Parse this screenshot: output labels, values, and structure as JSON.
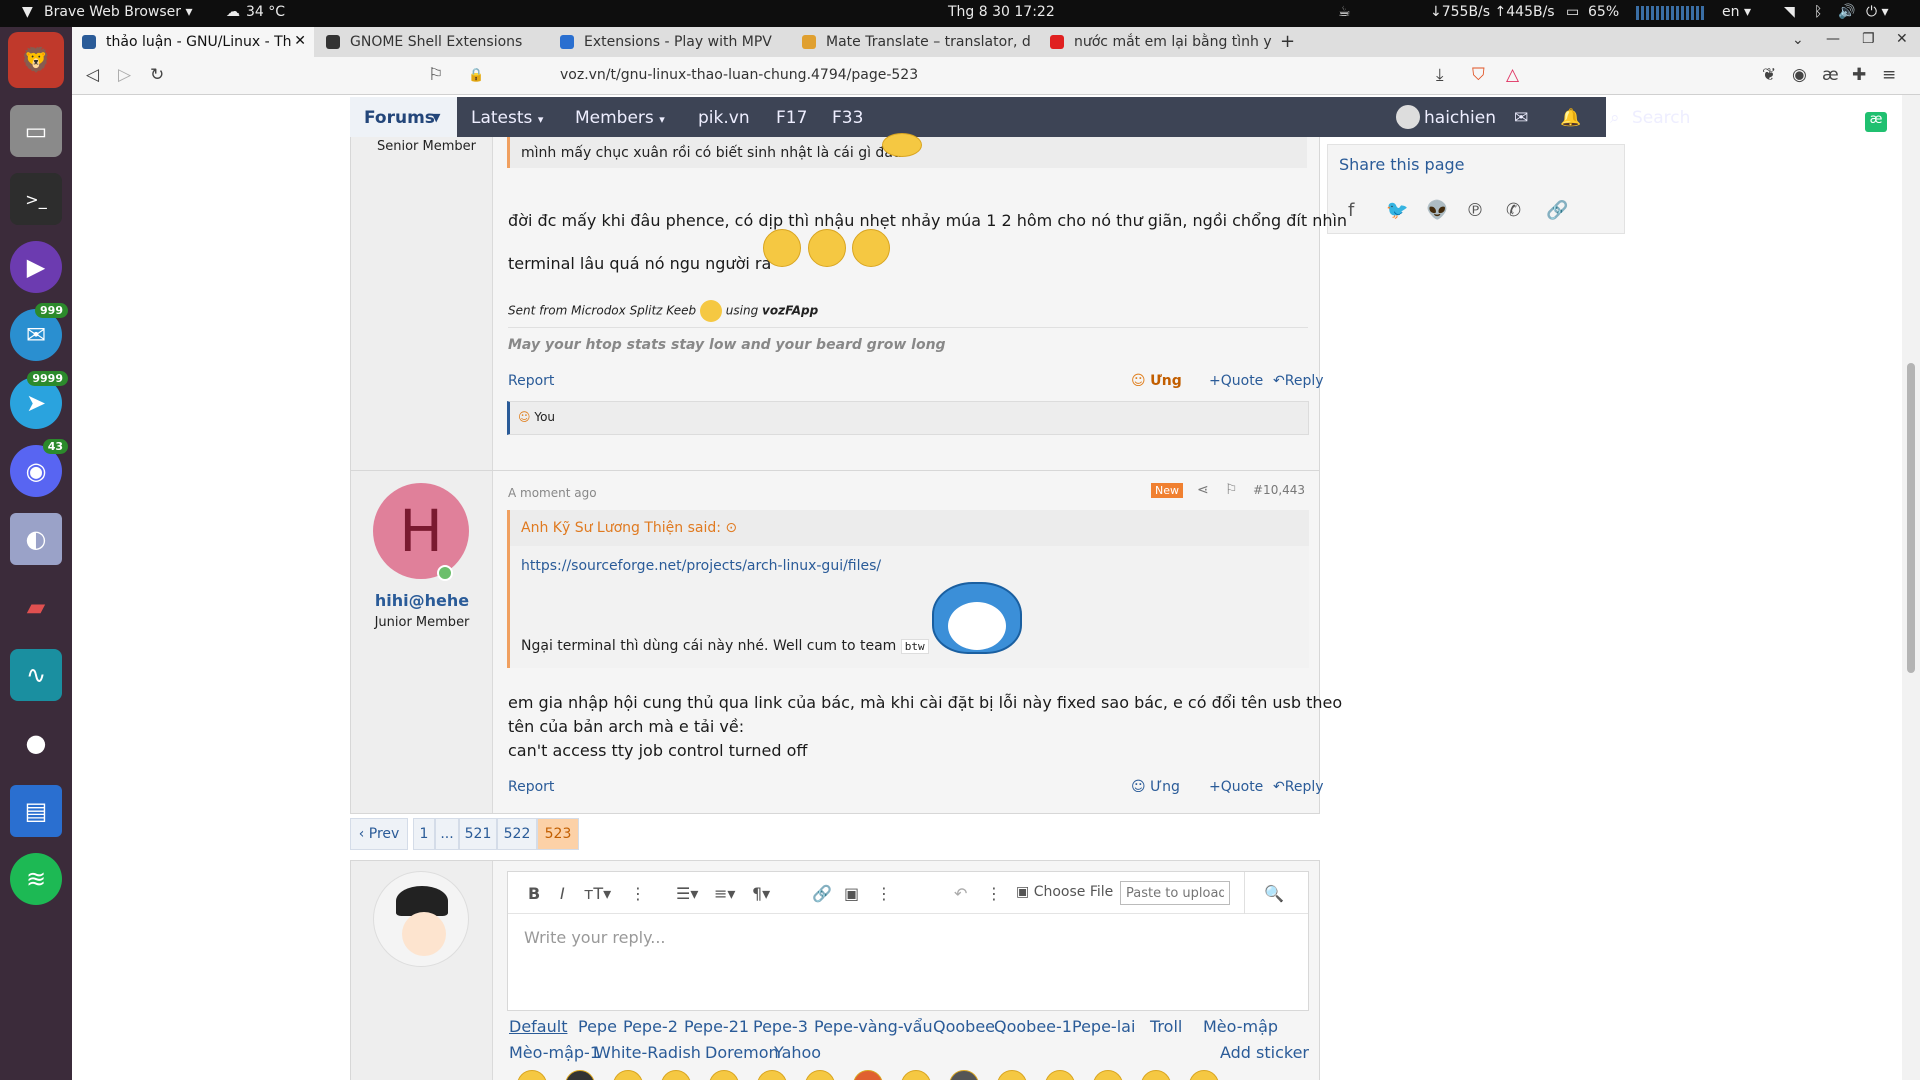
{
  "topbar": {
    "app_menu": "Brave Web Browser",
    "weather": "34 °C",
    "clock": "Thg 8 30  17:22",
    "net_speed": "↓755B/s ↑445B/s",
    "battery": "65%",
    "lang": "en"
  },
  "dock": {
    "badges": {
      "mail": "999",
      "telegram": "9999",
      "discord": "43"
    }
  },
  "tabs": [
    {
      "label": "thảo luận - GNU/Linux - Th",
      "active": true
    },
    {
      "label": "GNOME Shell Extensions"
    },
    {
      "label": "Extensions - Play with MPV"
    },
    {
      "label": "Mate Translate – translator, d"
    },
    {
      "label": "nước mắt em lại bằng tình y"
    }
  ],
  "address": {
    "url": "voz.vn/t/gnu-linux-thao-luan-chung.4794/page-523"
  },
  "nav": {
    "forums": "Forums",
    "latests": "Latests",
    "members": "Members",
    "pikvn": "pik.vn",
    "f17": "F17",
    "f33": "F33",
    "username": "haichien",
    "search": "Search"
  },
  "share": {
    "title": "Share this page"
  },
  "post1": {
    "member_title": "Senior Member",
    "quote_text": "mình mấy chục xuân rồi có biết sinh nhật là cái gì đâu",
    "line1": "đời đc mấy khi đâu phence, có dịp thì nhậu nhẹt nhảy múa 1 2 hôm cho nó thư giãn, ngồi chổng đít nhìn",
    "line2": "terminal lâu quá nó ngu người ra",
    "sent_prefix": "Sent from Microdox Splitz Keeb",
    "sent_using": "using",
    "sent_app": "vozFApp",
    "signature": "May your htop stats stay low and your beard grow long",
    "report": "Report",
    "react": "Ưng",
    "quote": "Quote",
    "reply": "Reply",
    "reacted_by": "You"
  },
  "post2": {
    "avatar_letter": "H",
    "username": "hihi@hehe",
    "member_title": "Junior Member",
    "time": "A moment ago",
    "badge_new": "New",
    "post_number": "#10,443",
    "quote_author": "Anh Kỹ Sư Lương Thiện said:",
    "quote_link": "https://sourceforge.net/projects/arch-linux-gui/files/",
    "quote_text": "Ngại terminal thì dùng cái này nhé. Well cum to team",
    "quote_code": "btw",
    "line1": "em gia nhập hội cung thủ qua link của bác, mà khi cài đặt bị lỗi này fixed sao bác, e có đổi tên usb theo",
    "line2": "tên của bản arch mà e tải về:",
    "line3": "can't access tty job control turned off",
    "report": "Report",
    "react": "Ưng",
    "quote": "Quote",
    "reply": "Reply"
  },
  "pager": {
    "prev": "Prev",
    "p1": "1",
    "ellipsis": "...",
    "p521": "521",
    "p522": "522",
    "p523": "523"
  },
  "editor": {
    "choose_file": "Choose File",
    "paste_placeholder": "Paste to upload",
    "reply_placeholder": "Write your reply...",
    "add_sticker": "Add sticker",
    "sticker_tabs_row1": [
      "Default",
      "Pepe",
      "Pepe-2",
      "Pepe-21",
      "Pepe-3",
      "Pepe-vàng-vẩu",
      "Qoobee",
      "Qoobee-1",
      "Pepe-lai",
      "Troll",
      "Mèo-mập"
    ],
    "sticker_tabs_row2": [
      "Mèo-mập-1",
      "White-Radish",
      "Doremon",
      "Yahoo"
    ]
  },
  "colors": {
    "nav_bg": "#3d4455",
    "link": "#2a5b98",
    "accent_orange": "#f0a060",
    "avatar_pink": "#e0809a"
  }
}
